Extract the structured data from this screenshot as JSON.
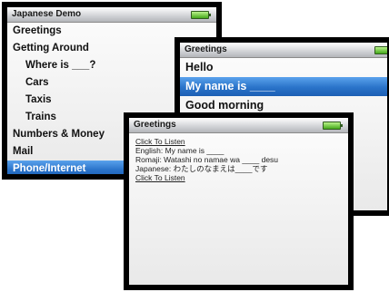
{
  "screen1": {
    "title": "Japanese Demo",
    "items": [
      {
        "label": "Greetings",
        "indent": false,
        "selected": false
      },
      {
        "label": "Getting Around",
        "indent": false,
        "selected": false
      },
      {
        "label": "Where is ___?",
        "indent": true,
        "selected": false
      },
      {
        "label": "Cars",
        "indent": true,
        "selected": false
      },
      {
        "label": "Taxis",
        "indent": true,
        "selected": false
      },
      {
        "label": "Trains",
        "indent": true,
        "selected": false
      },
      {
        "label": "Numbers & Money",
        "indent": false,
        "selected": false
      },
      {
        "label": "Mail",
        "indent": false,
        "selected": false
      },
      {
        "label": "Phone/Internet",
        "indent": false,
        "selected": true
      }
    ]
  },
  "screen2": {
    "title": "Greetings",
    "items": [
      {
        "label": "Hello",
        "selected": false
      },
      {
        "label": "My name is ____",
        "selected": true
      },
      {
        "label": "Good morning",
        "selected": false
      }
    ]
  },
  "screen3": {
    "title": "Greetings",
    "lines": [
      {
        "text": "Click To Listen",
        "link": true
      },
      {
        "text": "English: My name is ____",
        "link": false
      },
      {
        "text": "Romaji: Watashi no namae wa ____ desu",
        "link": false
      },
      {
        "text": "Japanese: わたしのなまえは____です",
        "link": false
      },
      {
        "text": "Click To Listen",
        "link": true
      }
    ]
  },
  "colors": {
    "selection": "#2a73c9",
    "battery": "#45a91b",
    "bezel": "#000000"
  },
  "icons": [
    "battery-icon"
  ]
}
